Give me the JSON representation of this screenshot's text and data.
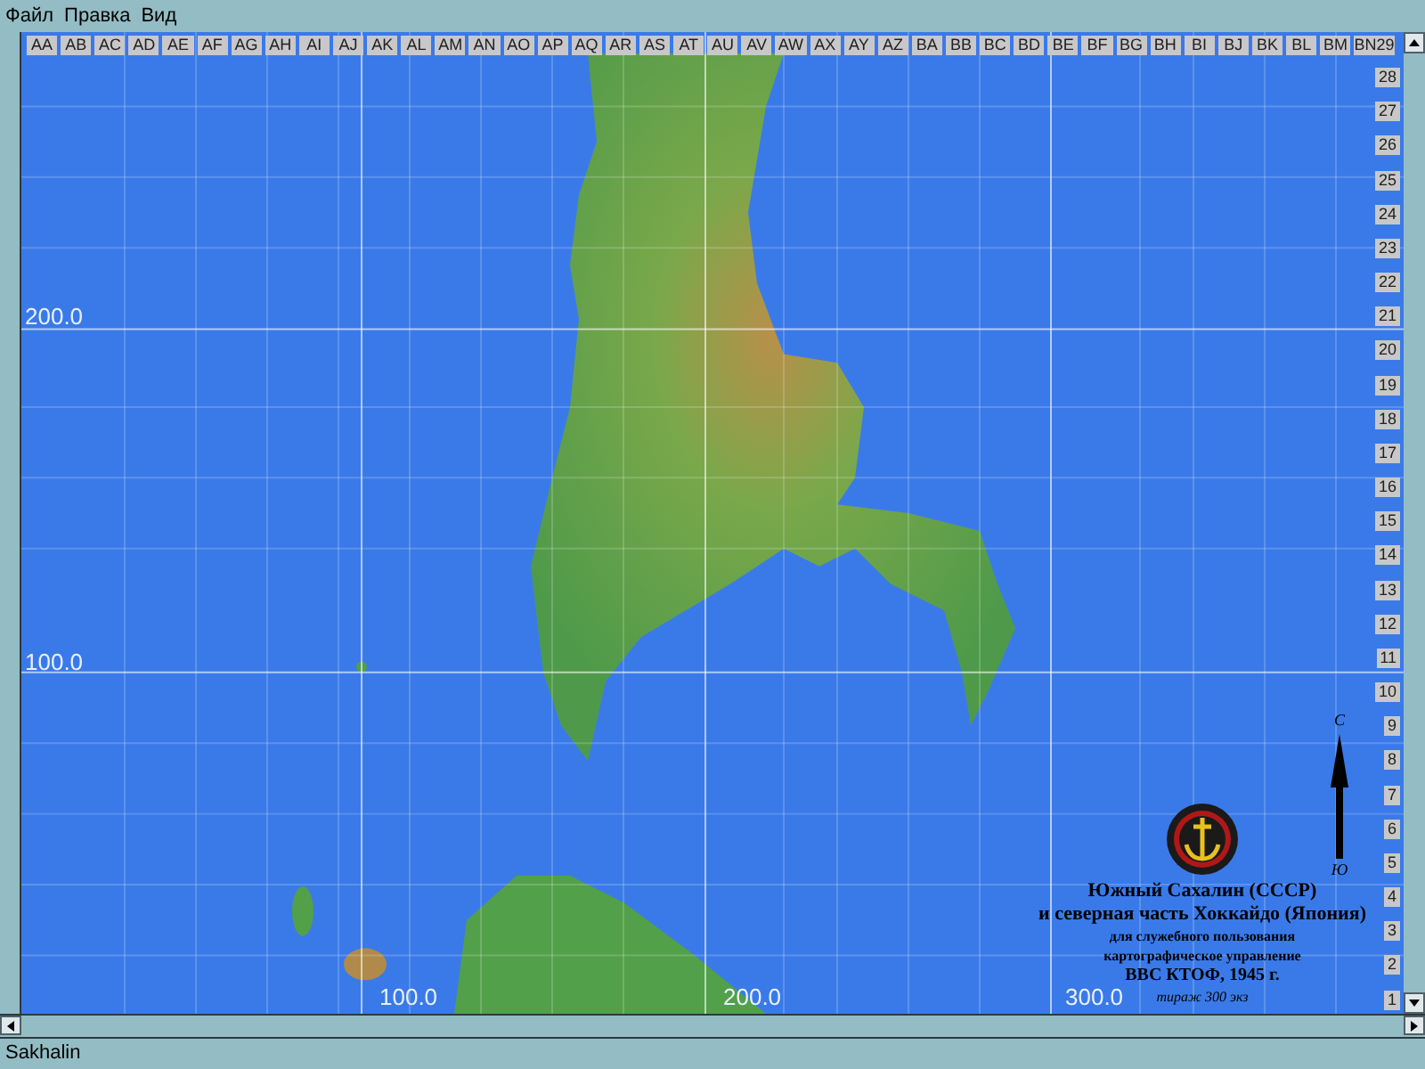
{
  "menu": [
    "Файл",
    "Правка",
    "Вид"
  ],
  "columns": [
    "AA",
    "AB",
    "AC",
    "AD",
    "AE",
    "AF",
    "AG",
    "AH",
    "AI",
    "AJ",
    "AK",
    "AL",
    "AM",
    "AN",
    "AO",
    "AP",
    "AQ",
    "AR",
    "AS",
    "AT",
    "AU",
    "AV",
    "AW",
    "AX",
    "AY",
    "AZ",
    "BA",
    "BB",
    "BC",
    "BD",
    "BE",
    "BF",
    "BG",
    "BH",
    "BI",
    "BJ",
    "BK",
    "BL",
    "BM",
    "BN29"
  ],
  "rows": [
    "28",
    "27",
    "26",
    "25",
    "24",
    "23",
    "22",
    "21",
    "20",
    "19",
    "18",
    "17",
    "16",
    "15",
    "14",
    "13",
    "12",
    "11",
    "10",
    "9",
    "8",
    "7",
    "6",
    "5",
    "4",
    "3",
    "2",
    "1"
  ],
  "left_axis": [
    "200.0",
    "100.0"
  ],
  "bottom_axis": [
    "100.0",
    "200.0",
    "300.0"
  ],
  "compass": {
    "north": "С",
    "south": "Ю"
  },
  "legend": {
    "title": [
      "Южный Сахалин (СССР)",
      "и северная часть Хоккайдо (Япония)"
    ],
    "notes": [
      "для служебного пользования",
      "картографическое управление",
      "ВВС КТОФ, 1945 г."
    ],
    "print_run": "тираж 300 экз"
  },
  "status_bar": "Sakhalin"
}
